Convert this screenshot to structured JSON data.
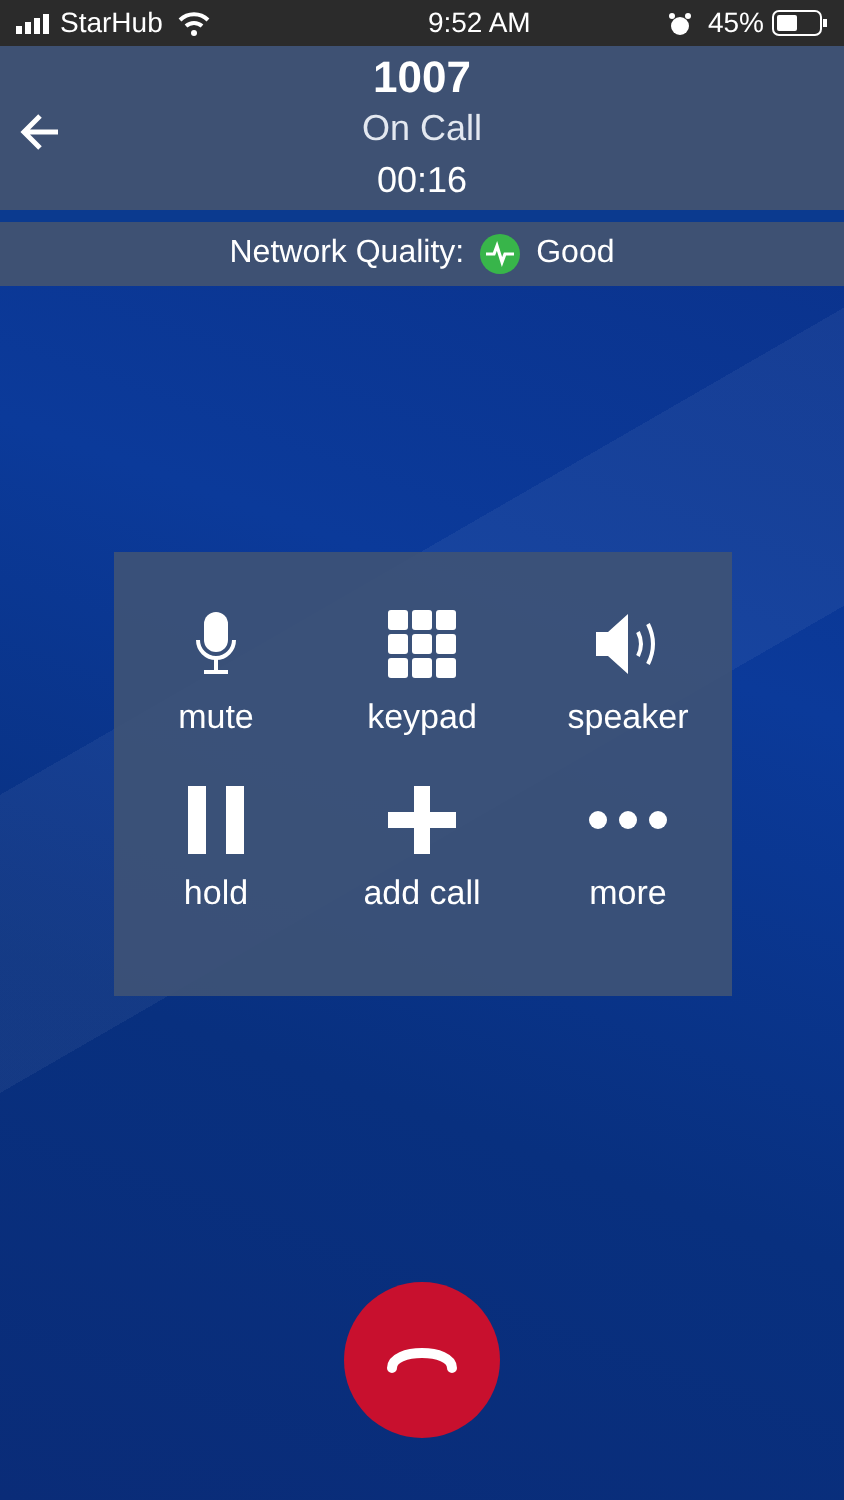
{
  "status_bar": {
    "carrier": "StarHub",
    "time": "9:52 AM",
    "battery": "45%"
  },
  "header": {
    "title": "1007",
    "status": "On Call",
    "timer": "00:16"
  },
  "network": {
    "label": "Network Quality:",
    "value": "Good"
  },
  "controls": [
    {
      "kind": "mic",
      "label": "mute"
    },
    {
      "kind": "keypad",
      "label": "keypad"
    },
    {
      "kind": "speaker",
      "label": "speaker"
    },
    {
      "kind": "hold",
      "label": "hold"
    },
    {
      "kind": "add",
      "label": "add call"
    },
    {
      "kind": "more",
      "label": "more"
    }
  ]
}
